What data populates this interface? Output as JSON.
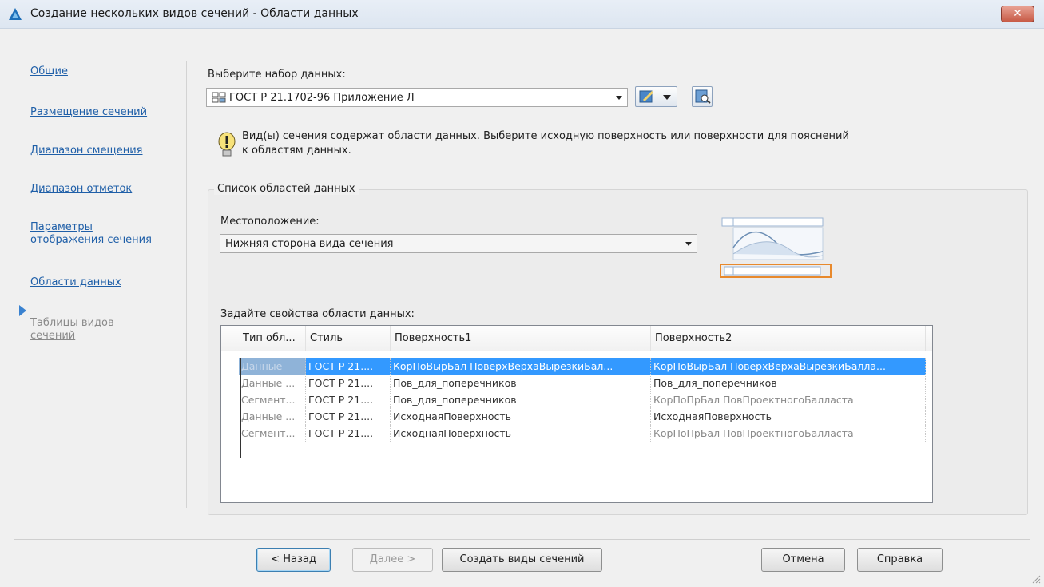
{
  "window": {
    "title": "Создание нескольких видов сечений - Области данных",
    "close_label": "✕"
  },
  "nav": {
    "items": [
      {
        "label": "Общие"
      },
      {
        "label": "Размещение сечений"
      },
      {
        "label": "Диапазон смещения"
      },
      {
        "label": "Диапазон отметок"
      },
      {
        "label_line1": "Параметры",
        "label_line2": "отображения сечения"
      },
      {
        "label": "Области данных",
        "current": true
      },
      {
        "label_line1": "Таблицы видов",
        "label_line2": "сечений",
        "disabled": true
      }
    ]
  },
  "dataset": {
    "label": "Выберите набор данных:",
    "value": "ГОСТ Р 21.1702-96 Приложение Л"
  },
  "info": {
    "line1": "Вид(ы) сечения содержат области данных. Выберите исходную поверхность или поверхности для пояснений",
    "line2": "к областям данных."
  },
  "group": {
    "title": "Список областей данных",
    "location_label": "Местоположение:",
    "location_value": "Нижняя сторона вида сечения",
    "props_label": "Задайте свойства области данных:"
  },
  "table": {
    "columns": [
      "Тип обл...",
      "Стиль",
      "Поверхность1",
      "Поверхность2"
    ],
    "rows": [
      {
        "type": "Данные",
        "style": "ГОСТ Р 21....",
        "surface1": "КорПоВырБал ПоверхВерхаВырезкиБал...",
        "surface2": "КорПоВырБал ПоверхВерхаВырезкиБалла...",
        "selected": true
      },
      {
        "type": "Данные ...",
        "style": "ГОСТ Р 21....",
        "surface1": "Пов_для_поперечников",
        "surface2": "Пов_для_поперечников",
        "surface2_grey": false
      },
      {
        "type": "Сегмент...",
        "style": "ГОСТ Р 21....",
        "surface1": "Пов_для_поперечников",
        "surface2": "КорПоПрБал ПовПроектногоБалласта",
        "surface2_grey": true
      },
      {
        "type": "Данные ...",
        "style": "ГОСТ Р 21....",
        "surface1": "ИсходнаяПоверхность",
        "surface2": "ИсходнаяПоверхность",
        "surface2_grey": false
      },
      {
        "type": "Сегмент...",
        "style": "ГОСТ Р 21....",
        "surface1": "ИсходнаяПоверхность",
        "surface2": "КорПоПрБал ПовПроектногоБалласта",
        "surface2_grey": true
      }
    ]
  },
  "buttons": {
    "back": "< Назад",
    "next": "Далее >",
    "create": "Создать виды сечений",
    "cancel": "Отмена",
    "help": "Справка"
  },
  "colors": {
    "link": "#1f5fa8",
    "selection": "#3399ff",
    "highlight_frame": "#e8892c"
  }
}
